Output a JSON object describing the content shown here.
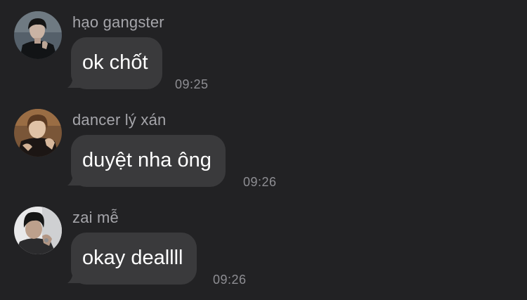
{
  "chat": {
    "messages": [
      {
        "sender": "hạo gangster",
        "text": "ok chốt",
        "time": "09:25",
        "avatar_icon": "user-avatar-photo"
      },
      {
        "sender": "dancer lý xán",
        "text": "duyệt nha ông",
        "time": "09:26",
        "avatar_icon": "user-avatar-photo"
      },
      {
        "sender": "zai mễ",
        "text": "okay deallll",
        "time": "09:26",
        "avatar_icon": "user-avatar-photo"
      }
    ]
  },
  "colors": {
    "background": "#222224",
    "bubble": "#3a3a3c",
    "message_text": "#ffffff",
    "sender_name": "#a5a5aa",
    "timestamp": "#8e8e93"
  }
}
